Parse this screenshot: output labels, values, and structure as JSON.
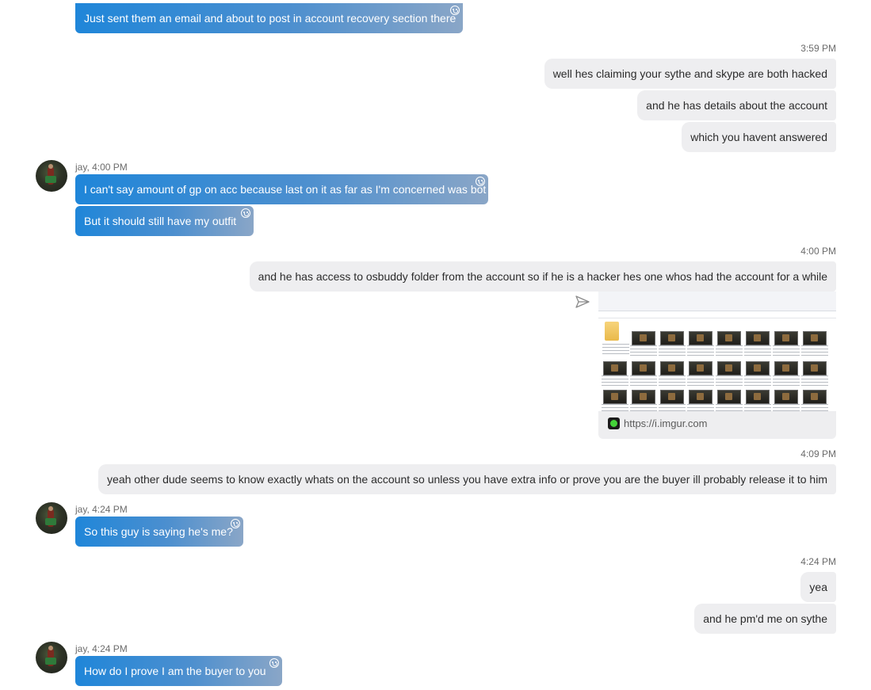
{
  "contact": {
    "name": "jay"
  },
  "messages": {
    "m1": {
      "text": "Just sent them an email and about to post in account recovery section there"
    },
    "ts1": {
      "time": "3:59 PM"
    },
    "m2": {
      "text": "well hes claiming your sythe and skype are both hacked"
    },
    "m3": {
      "text": "and he has details about the account"
    },
    "m4": {
      "text": "which you havent answered"
    },
    "s1": {
      "label": "jay, 4:00 PM"
    },
    "m5": {
      "text": "I can't say amount of gp on acc because last on it as far as I'm concerned was bot"
    },
    "m6": {
      "text": "But it should still have my outfit"
    },
    "ts2": {
      "time": "4:00 PM"
    },
    "m7": {
      "text": "and he has access to osbuddy folder from the account so if he is a hacker hes one whos had the account for a while"
    },
    "attachment": {
      "url": "https://i.imgur.com"
    },
    "ts3": {
      "time": "4:09 PM"
    },
    "m8": {
      "text": "yeah other dude seems to know exactly whats on the account so unless you have extra info or prove you are the buyer ill probably release it to him"
    },
    "s2": {
      "label": "jay, 4:24 PM"
    },
    "m9": {
      "text": "So this guy is saying he's me?"
    },
    "ts4": {
      "time": "4:24 PM"
    },
    "m10": {
      "text": "yea"
    },
    "m11": {
      "text": "and he pm'd me on sythe"
    },
    "s3": {
      "label": "jay, 4:24 PM"
    },
    "m12": {
      "text": "How do I prove I am the buyer to you"
    }
  },
  "colors": {
    "incoming_bubble_start": "#1f86d9",
    "incoming_bubble_end": "#8aa6c7",
    "outgoing_bubble": "#eeeef0",
    "favicon_green": "#44d339"
  },
  "icons": {
    "reaction": "smiley-icon",
    "share": "send-arrow-icon",
    "favicon": "imgur-favicon-icon"
  }
}
